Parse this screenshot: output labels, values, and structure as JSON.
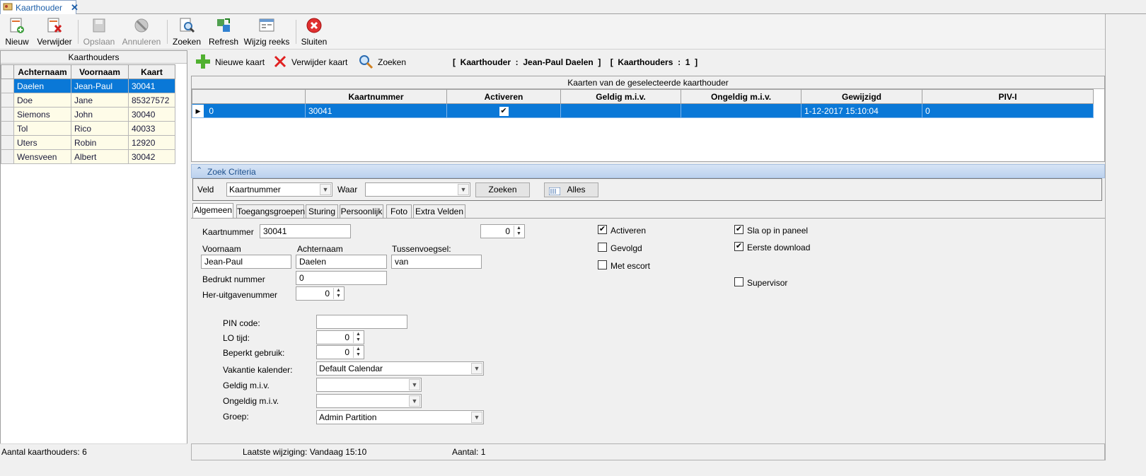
{
  "tab": {
    "title": "Kaarthouder",
    "close": "✕"
  },
  "toolbar": [
    {
      "label": "Nieuw",
      "icon": "new-icon",
      "enabled": true
    },
    {
      "label": "Verwijder",
      "icon": "delete-icon",
      "enabled": true
    },
    {
      "label": "Opslaan",
      "icon": "save-icon",
      "enabled": false
    },
    {
      "label": "Annuleren",
      "icon": "cancel-icon",
      "enabled": false
    },
    {
      "label": "Zoeken",
      "icon": "search-icon",
      "enabled": true
    },
    {
      "label": "Refresh",
      "icon": "refresh-icon",
      "enabled": true
    },
    {
      "label": "Wijzig reeks",
      "icon": "batch-edit-icon",
      "enabled": true
    },
    {
      "label": "Sluiten",
      "icon": "close-icon",
      "enabled": true
    }
  ],
  "left": {
    "title": "Kaarthouders",
    "columns": [
      "Achternaam",
      "Voornaam",
      "Kaart"
    ],
    "rows": [
      [
        "Daelen",
        "Jean-Paul",
        "30041"
      ],
      [
        "Doe",
        "Jane",
        "85327572"
      ],
      [
        "Siemons",
        "John",
        "30040"
      ],
      [
        "Tol",
        "Rico",
        "40033"
      ],
      [
        "Uters",
        "Robin",
        "12920"
      ],
      [
        "Wensveen",
        "Albert",
        "30042"
      ]
    ],
    "status": "Aantal kaarthouders: 6"
  },
  "right": {
    "new_card": "Nieuwe kaart",
    "delete_card": "Verwijder kaart",
    "search": "Zoeken",
    "info": "[  Kaarthouder  :  Jean-Paul Daelen  ]    [  Kaarthouders  :  1  ]",
    "cards_title": "Kaarten van de geselecteerde kaarthouder",
    "card_columns": [
      "",
      "Kaartnummer",
      "Activeren",
      "Geldig m.i.v.",
      "Ongeldig m.i.v.",
      "Gewijzigd",
      "PIV-I"
    ],
    "card_row": {
      "id": "0",
      "kaartnummer": "30041",
      "activeren": "✔",
      "geldig": "",
      "ongeldig": "",
      "gewijzigd": "1-12-2017 15:10:04",
      "piv": "0"
    }
  },
  "criteria": {
    "header": "Zoek Criteria",
    "veld_label": "Veld",
    "veld_value": "Kaartnummer",
    "waar_label": "Waar",
    "waar_value": "",
    "zoeken": "Zoeken",
    "alles": "Alles"
  },
  "tabs": [
    "Algemeen",
    "Toegangsgroepen",
    "Sturing",
    "Persoonlijk",
    "Foto",
    "Extra Velden"
  ],
  "form": {
    "kaartnummer_label": "Kaartnummer",
    "kaartnummer": "30041",
    "extra_spin": "0",
    "voornaam_label": "Voornaam",
    "achternaam_label": "Achternaam",
    "tussen_label": "Tussenvoegsel:",
    "voornaam": "Jean-Paul",
    "achternaam": "Daelen",
    "tussen": "van",
    "bedrukt_label": "Bedrukt nummer",
    "bedrukt": "0",
    "heruitgave_label": "Her-uitgavenummer",
    "heruitgave": "0",
    "pin_label": "PIN code:",
    "pin": "",
    "lo_label": "LO tijd:",
    "lo": "0",
    "beperkt_label": "Beperkt gebruik:",
    "beperkt": "0",
    "vakantie_label": "Vakantie kalender:",
    "vakantie": "Default Calendar",
    "geldig_label": "Geldig m.i.v.",
    "geldig": "",
    "ongeldig_label": "Ongeldig m.i.v.",
    "ongeldig": "",
    "groep_label": "Groep:",
    "groep": "Admin Partition",
    "activeren": "Activeren",
    "gevolgd": "Gevolgd",
    "escort": "Met escort",
    "sla_op": "Sla op in paneel",
    "eerste": "Eerste download",
    "supervisor": "Supervisor",
    "check_mark": "✔"
  },
  "status": {
    "laatste": "Laatste wijziging: Vandaag 15:10",
    "aantal": "Aantal: 1"
  },
  "colors": {
    "selection": "#0a78d7",
    "row_bg": "#fefce8",
    "header_blue": "#bcd2ee"
  }
}
